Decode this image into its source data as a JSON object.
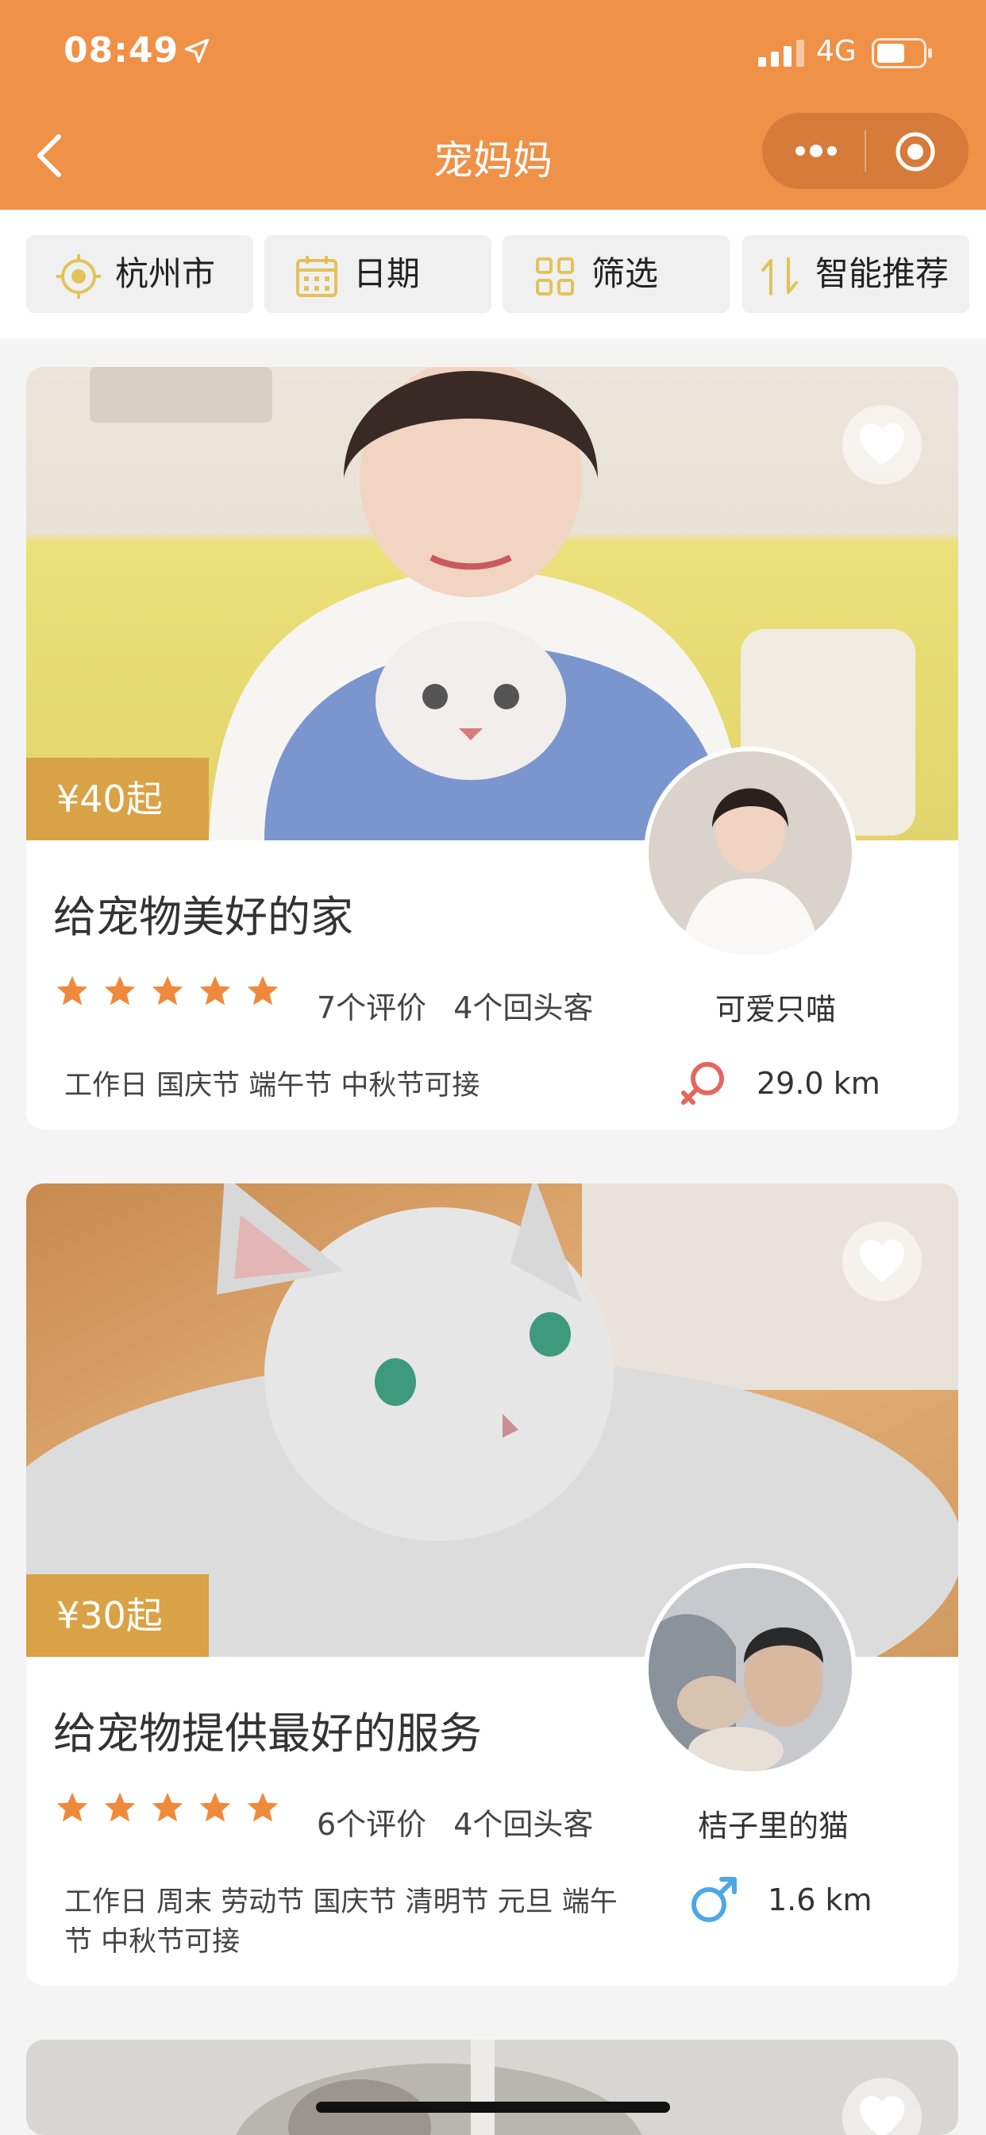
{
  "status_bar": {
    "time": "08:49",
    "network": "4G"
  },
  "nav": {
    "title": "宠妈妈"
  },
  "filters": [
    {
      "label": "杭州市",
      "icon": "location-target-icon"
    },
    {
      "label": "日期",
      "icon": "calendar-icon"
    },
    {
      "label": "筛选",
      "icon": "grid-filter-icon"
    },
    {
      "label": "智能推荐",
      "icon": "sort-icon"
    }
  ],
  "listings": [
    {
      "price": "¥40起",
      "title": "给宠物美好的家",
      "rating": 5,
      "reviews": "7个评价",
      "repeat_customers": "4个回头客",
      "available": "工作日 国庆节 端午节 中秋节可接",
      "host_name": "可爱只喵",
      "gender": "female",
      "distance": "29.0 km",
      "favorited": false
    },
    {
      "price": "¥30起",
      "title": "给宠物提供最好的服务",
      "rating": 5,
      "reviews": "6个评价",
      "repeat_customers": "4个回头客",
      "available": "工作日 周末 劳动节 国庆节 清明节 元旦 端午节 中秋节可接",
      "host_name": "桔子里的猫",
      "gender": "male",
      "distance": "1.6 km",
      "favorited": false
    }
  ],
  "colors": {
    "accent": "#ef9147",
    "star": "#ef8a3c",
    "price_tag": "#d9a246",
    "female": "#e3675f",
    "male": "#4ea6e6"
  }
}
